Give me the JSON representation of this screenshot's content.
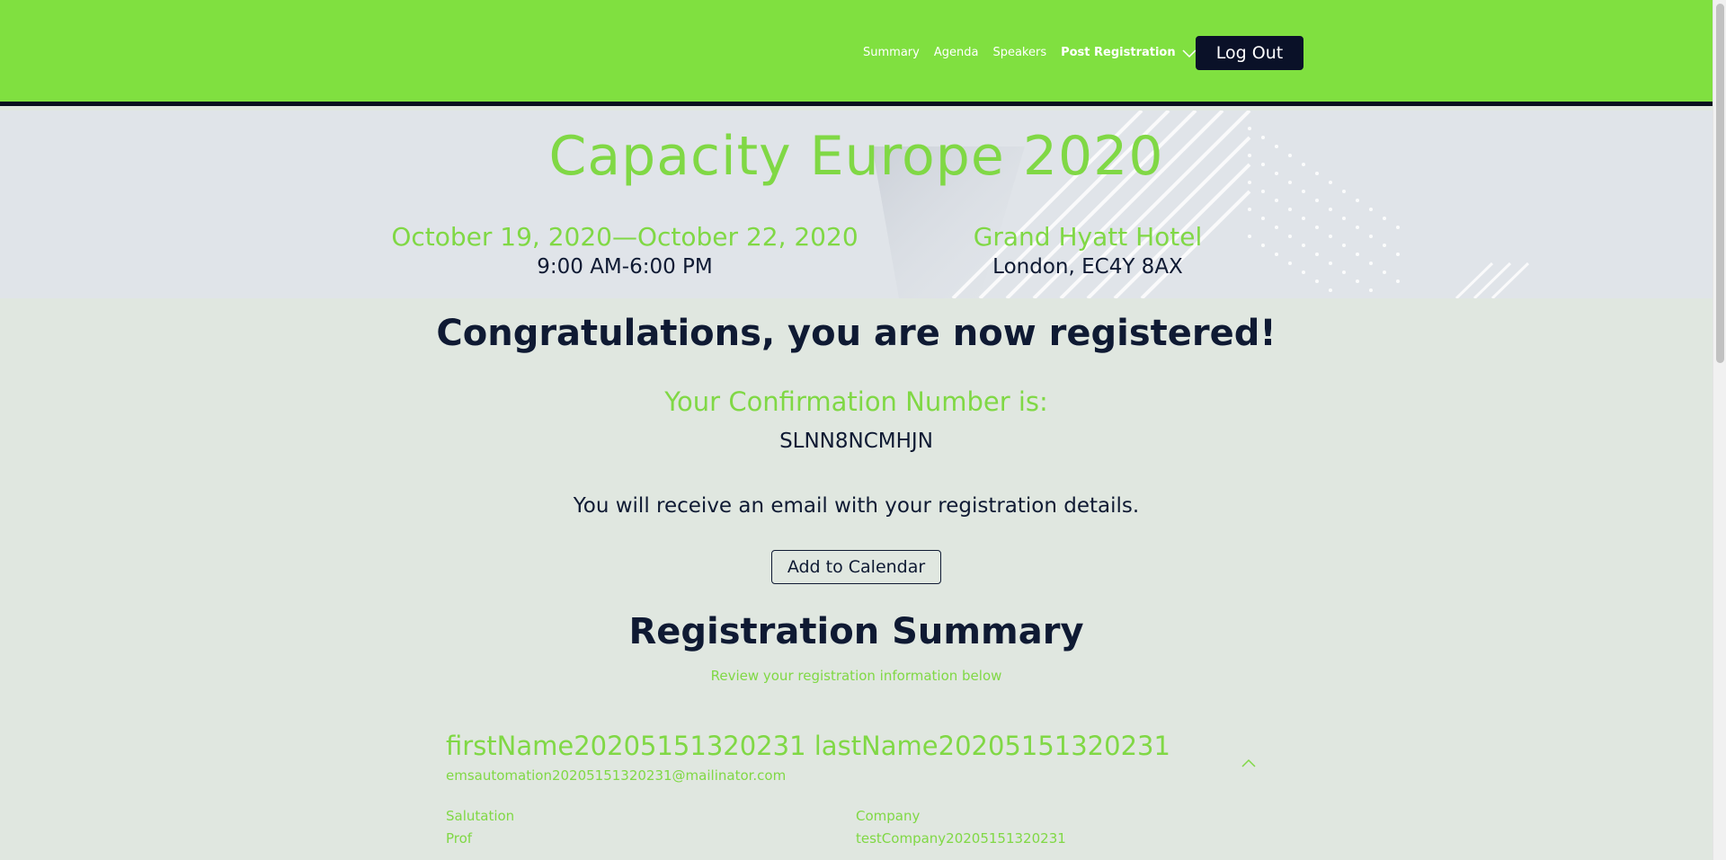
{
  "header": {
    "nav": [
      "Summary",
      "Agenda",
      "Speakers"
    ],
    "nav_active": "Post Registration",
    "logout_label": "Log Out"
  },
  "event": {
    "title": "Capacity Europe 2020",
    "dates": "October 19, 2020—October 22, 2020",
    "time": "9:00 AM-6:00 PM",
    "venue": "Grand Hyatt Hotel",
    "location": "London, EC4Y 8AX"
  },
  "confirmation": {
    "heading": "Congratulations, you are now registered!",
    "number_label": "Your Confirmation Number is:",
    "number": "SLNN8NCMHJN",
    "email_message": "You will receive an email with your registration details.",
    "calendar_button": "Add to Calendar"
  },
  "summary": {
    "title": "Registration Summary",
    "subtitle": "Review your registration information below",
    "attendee_name": "firstName20205151320231 lastName20205151320231",
    "attendee_email": "emsautomation20205151320231@mailinator.com",
    "fields": [
      {
        "label": "Salutation",
        "value": "Prof"
      },
      {
        "label": "Company",
        "value": "testCompany20205151320231"
      }
    ]
  },
  "colors": {
    "accent_green": "#80e040",
    "text_green": "#80d845",
    "navy": "#0a1128",
    "page_bg": "#e0e7e0"
  }
}
